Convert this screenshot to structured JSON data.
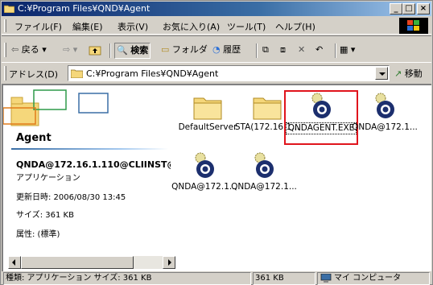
{
  "window": {
    "title": "C:¥Program Files¥QND¥Agent",
    "minimize_label": "_",
    "maximize_label": "□",
    "close_label": "×"
  },
  "menu": {
    "items": [
      "ファイル(F)",
      "編集(E)",
      "表示(V)",
      "お気に入り(A)",
      "ツール(T)",
      "ヘルプ(H)"
    ]
  },
  "toolbar": {
    "back_label": "戻る",
    "search_label": "検索",
    "folders_label": "フォルダ",
    "history_label": "履歴"
  },
  "address": {
    "label": "アドレス(D)",
    "value": "C:¥Program Files¥QND¥Agent",
    "go_label": "移動"
  },
  "info_pane": {
    "folder_name": "Agent",
    "selected_name": "QNDA@172.16.1.110@CLIINST@(",
    "selected_type": "アプリケーション",
    "modified": "更新日時: 2006/08/30 13:45",
    "size": "サイズ: 361 KB",
    "attributes": "属性: (標準)"
  },
  "files": [
    {
      "label": "DefaultServer",
      "icon": "folder-icon",
      "selected": false
    },
    {
      "label": "STA(172.16.1...",
      "icon": "folder-icon",
      "selected": false
    },
    {
      "label": "QNDAGENT.EXE",
      "icon": "qnd-app-icon",
      "selected": true
    },
    {
      "label": "QNDA@172.1...",
      "icon": "qnd-app-icon",
      "selected": false
    },
    {
      "label": "QNDA@172.1...",
      "icon": "qnd-app-icon",
      "selected": false
    },
    {
      "label": "QNDA@172.1...",
      "icon": "qnd-app-icon",
      "selected": false
    }
  ],
  "status": {
    "description": "種類: アプリケーション サイズ: 361 KB",
    "size": "361 KB",
    "zone": "マイ コンピュータ"
  },
  "colors": {
    "titlebar": "#0a246a",
    "highlight_box": "#e0141c",
    "folder": "#f5d77b"
  }
}
